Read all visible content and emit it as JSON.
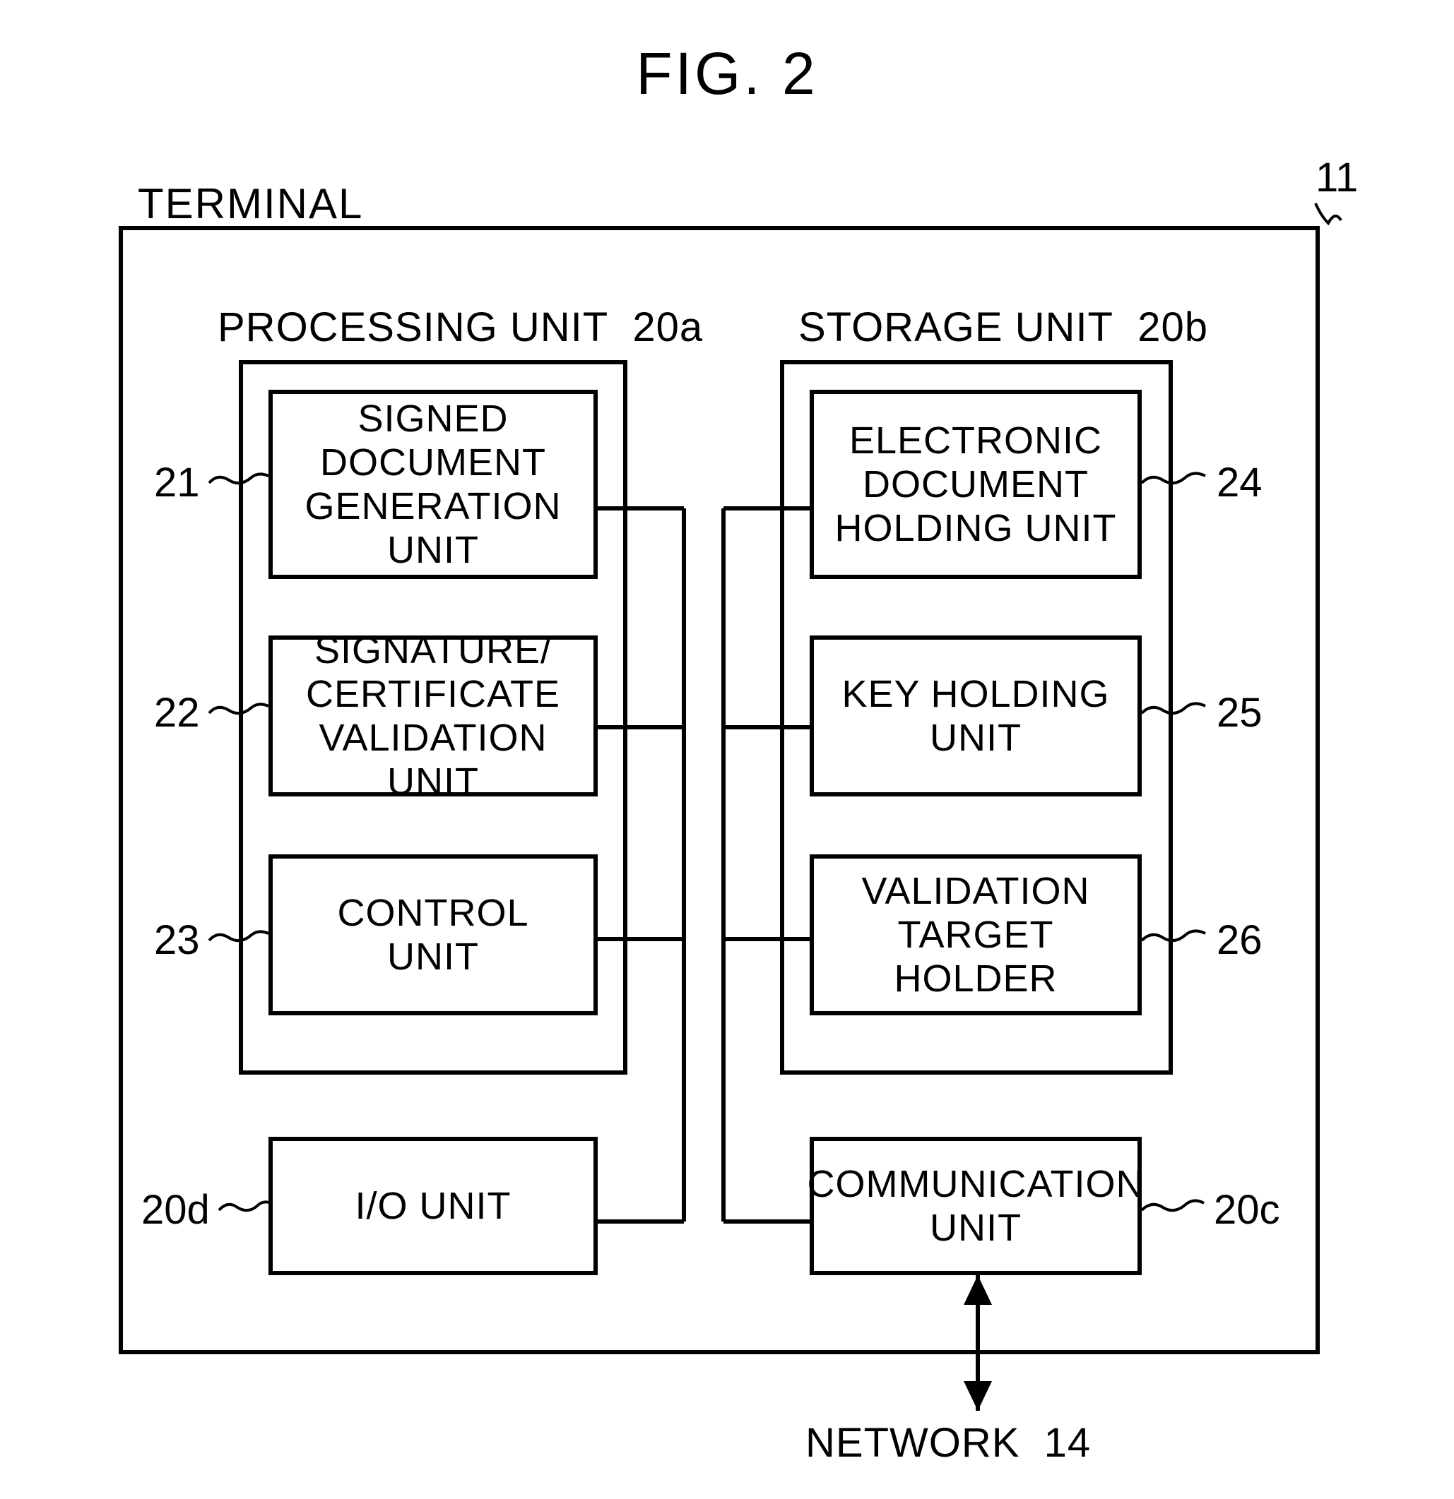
{
  "figure_title": "FIG. 2",
  "terminal_label": "TERMINAL",
  "terminal_ref": "11",
  "processing_unit": {
    "header": "PROCESSING UNIT",
    "ref": "20a",
    "items": [
      {
        "ref": "21",
        "label": "SIGNED\nDOCUMENT\nGENERATION\nUNIT"
      },
      {
        "ref": "22",
        "label": "SIGNATURE/\nCERTIFICATE\nVALIDATION UNIT"
      },
      {
        "ref": "23",
        "label": "CONTROL\nUNIT"
      }
    ]
  },
  "storage_unit": {
    "header": "STORAGE UNIT",
    "ref": "20b",
    "items": [
      {
        "ref": "24",
        "label": "ELECTRONIC\nDOCUMENT\nHOLDING UNIT"
      },
      {
        "ref": "25",
        "label": "KEY HOLDING\nUNIT"
      },
      {
        "ref": "26",
        "label": "VALIDATION\nTARGET\nHOLDER"
      }
    ]
  },
  "io_unit": {
    "ref": "20d",
    "label": "I/O UNIT"
  },
  "comm_unit": {
    "ref": "20c",
    "label": "COMMUNICATION\nUNIT"
  },
  "network": {
    "label": "NETWORK",
    "ref": "14"
  }
}
